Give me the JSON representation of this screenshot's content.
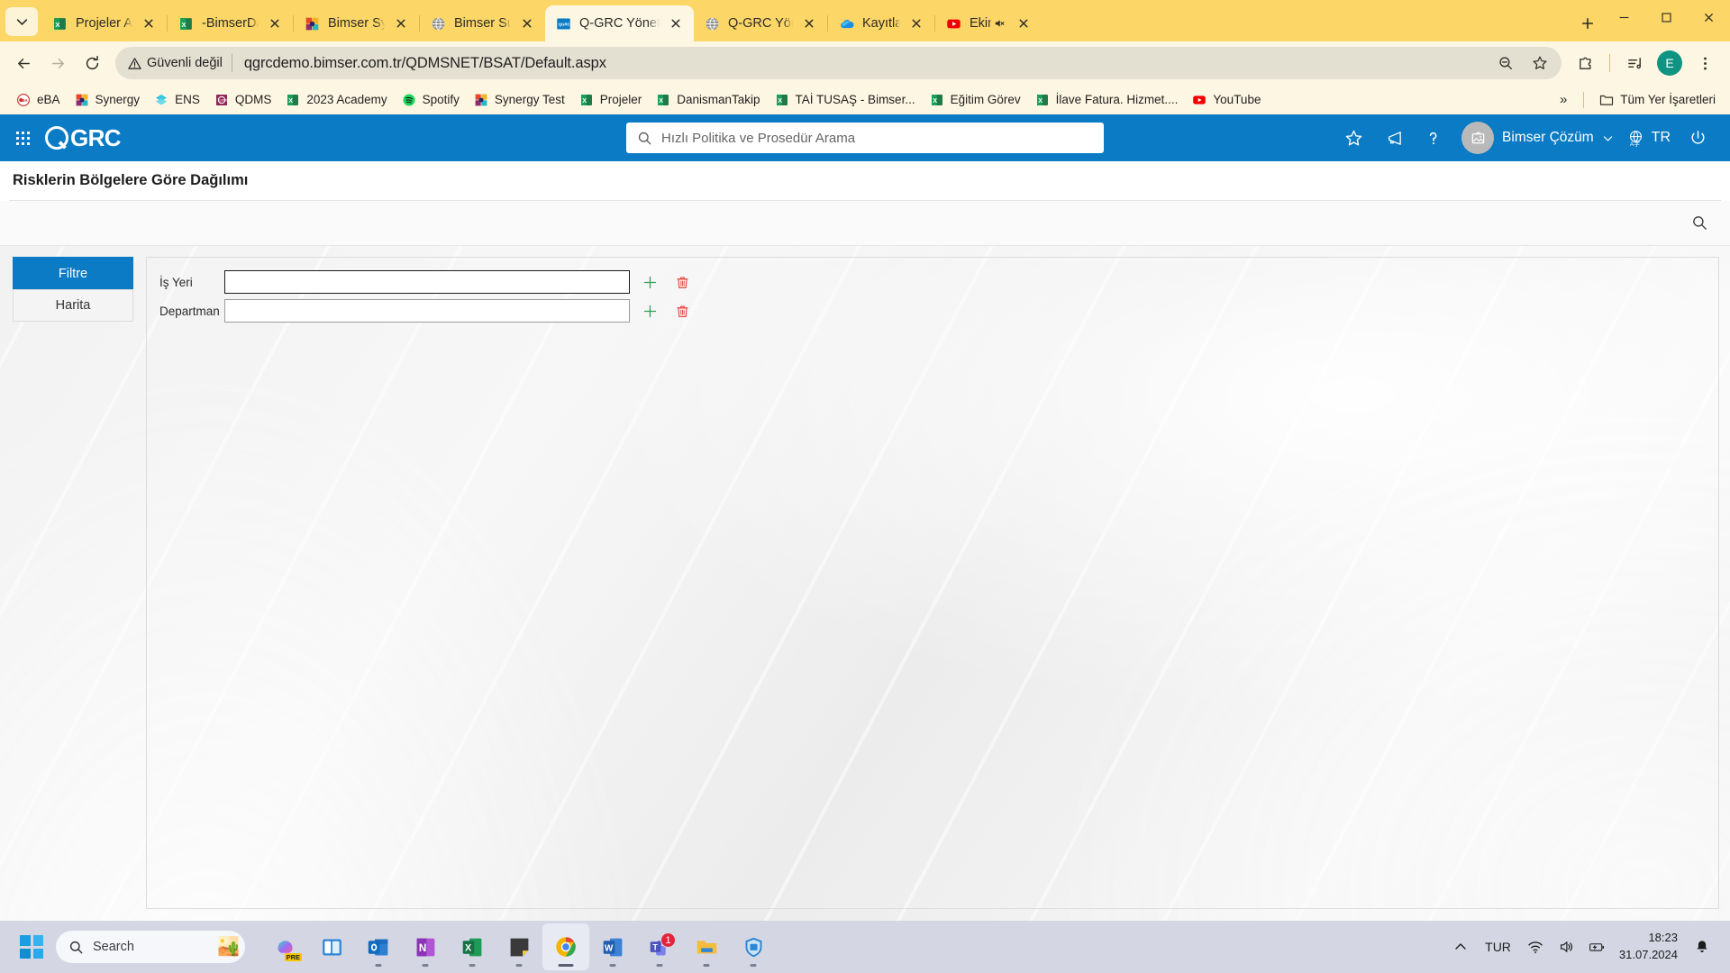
{
  "browser": {
    "tabs": [
      {
        "title": "Projeler Applicati",
        "icon": "excel-icon",
        "active": false
      },
      {
        "title": "-BimserDanisman",
        "icon": "excel-icon",
        "active": false
      },
      {
        "title": "Bimser Synergy",
        "icon": "synergy-icon",
        "active": false
      },
      {
        "title": "Bimser Support S",
        "icon": "globe-icon",
        "active": false
      },
      {
        "title": "Q-GRC Yönetim S",
        "icon": "qgrc-icon",
        "active": true
      },
      {
        "title": "Q-GRC Yönetim",
        "icon": "globe-icon",
        "active": false
      },
      {
        "title": "Kayıtlar - OneDri",
        "icon": "onedrive-icon",
        "active": false
      },
      {
        "title": "Ekin Uzunlar",
        "icon": "youtube-icon",
        "active": false,
        "muted": true
      }
    ],
    "address": {
      "security_label": "Güvenli değil",
      "url": "qgrcdemo.bimser.com.tr/QDMSNET/BSAT/Default.aspx"
    },
    "profile_initial": "E",
    "bookmarks": [
      {
        "label": "eBA",
        "icon": "eba-icon"
      },
      {
        "label": "Synergy",
        "icon": "synergy-icon"
      },
      {
        "label": "ENS",
        "icon": "ens-icon"
      },
      {
        "label": "QDMS",
        "icon": "qdms-icon"
      },
      {
        "label": "2023 Academy",
        "icon": "excel-icon"
      },
      {
        "label": "Spotify",
        "icon": "spotify-icon"
      },
      {
        "label": "Synergy Test",
        "icon": "synergy-icon"
      },
      {
        "label": "Projeler",
        "icon": "excel-icon"
      },
      {
        "label": "DanismanTakip",
        "icon": "excel-icon"
      },
      {
        "label": "TAİ TUSAŞ - Bimser...",
        "icon": "excel-icon"
      },
      {
        "label": "Eğitim Görev",
        "icon": "excel-icon"
      },
      {
        "label": "İlave Fatura. Hizmet....",
        "icon": "excel-icon"
      },
      {
        "label": "YouTube",
        "icon": "youtube-icon"
      }
    ],
    "bookmarks_overflow": "»",
    "all_bookmarks_label": "Tüm Yer İşaretleri"
  },
  "app": {
    "brand": "GRC",
    "search_placeholder": "Hızlı Politika ve Prosedür Arama",
    "user_name": "Bimser Çözüm",
    "language": "TR",
    "page_title": "Risklerin Bölgelere Göre Dağılımı",
    "tabs": [
      {
        "label": "Filtre",
        "active": true
      },
      {
        "label": "Harita",
        "active": false
      }
    ],
    "form": {
      "fields": [
        {
          "label": "İş Yeri",
          "value": "",
          "focused": true
        },
        {
          "label": "Departman",
          "value": "",
          "focused": false
        }
      ],
      "add_title": "Ekle",
      "delete_title": "Sil"
    },
    "accent_color": "#0a7bc4"
  },
  "taskbar": {
    "search_placeholder": "Search",
    "items": [
      {
        "name": "copilot",
        "running": false
      },
      {
        "name": "widgets",
        "running": false
      },
      {
        "name": "outlook",
        "running": true
      },
      {
        "name": "onenote",
        "running": true
      },
      {
        "name": "excel",
        "running": true
      },
      {
        "name": "sticky-notes",
        "running": true
      },
      {
        "name": "chrome",
        "running": true,
        "active": true
      },
      {
        "name": "word",
        "running": true
      },
      {
        "name": "teams",
        "running": true,
        "badge": "1"
      },
      {
        "name": "file-explorer",
        "running": true
      },
      {
        "name": "security",
        "running": true
      }
    ],
    "language": "TUR",
    "time": "18:23",
    "date": "31.07.2024"
  }
}
